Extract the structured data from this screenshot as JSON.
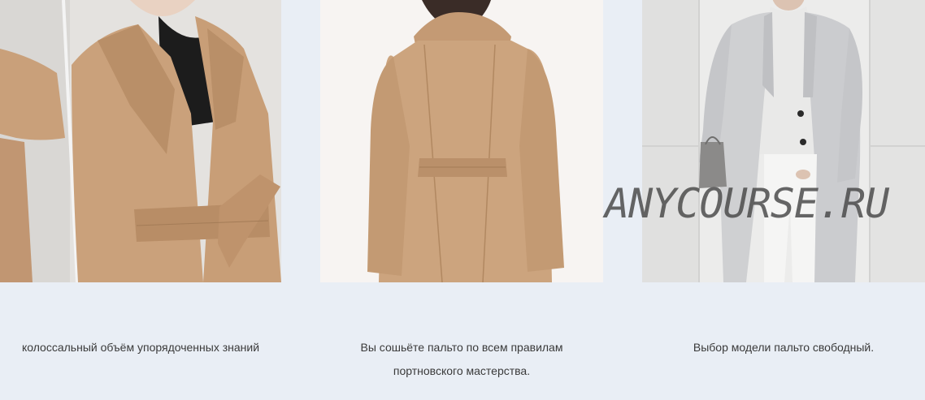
{
  "cards": [
    {
      "caption": "колоссальный объём упорядоченных знаний",
      "image_alt": "Woman in camel belted wrap coat, front view"
    },
    {
      "caption": "Вы сошьёте пальто по всем правилам портновского мастерства.",
      "image_alt": "Camel belted coat, back view"
    },
    {
      "caption": "Выбор модели пальто свободный.",
      "image_alt": "Woman in light grey straight coat with grey bag"
    }
  ],
  "watermark": "ANYCOURSE.RU",
  "colors": {
    "page_background": "#e9eef5",
    "camel": "#c8a27c",
    "grey_coat": "#cfd0d2",
    "caption_text": "#3a3a3a"
  }
}
